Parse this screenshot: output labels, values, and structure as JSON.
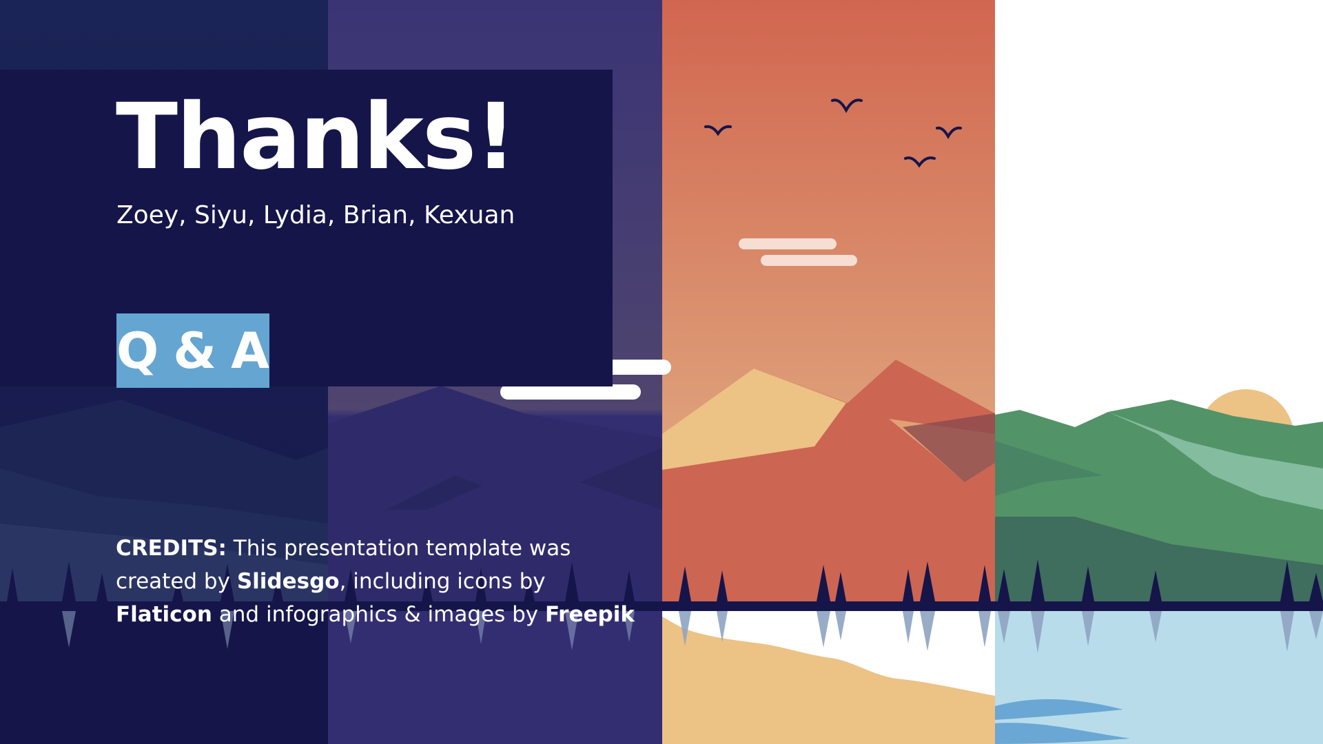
{
  "slide": {
    "title": "Thanks!",
    "names": "Zoey, Siyu, Lydia, Brian, Kexuan",
    "qa_label": "Q & A",
    "credits": {
      "label": "CREDITS:",
      "text1": " This presentation template was created by ",
      "slidesgo": "Slidesgo",
      "text2": ", including icons by ",
      "flaticon": "Flaticon",
      "text3": " and infographics & images by ",
      "freepik": "Freepik"
    }
  },
  "colors": {
    "navy": "#15154a",
    "purple": "#332e72",
    "orange_top": "#d1664f",
    "orange_bottom": "#dea27b",
    "sand": "#ecc285",
    "green": "#539368",
    "light_green": "#84bc9f",
    "water": "#b8dcea",
    "accent_blue": "#64a5d2",
    "white": "#ffffff"
  }
}
